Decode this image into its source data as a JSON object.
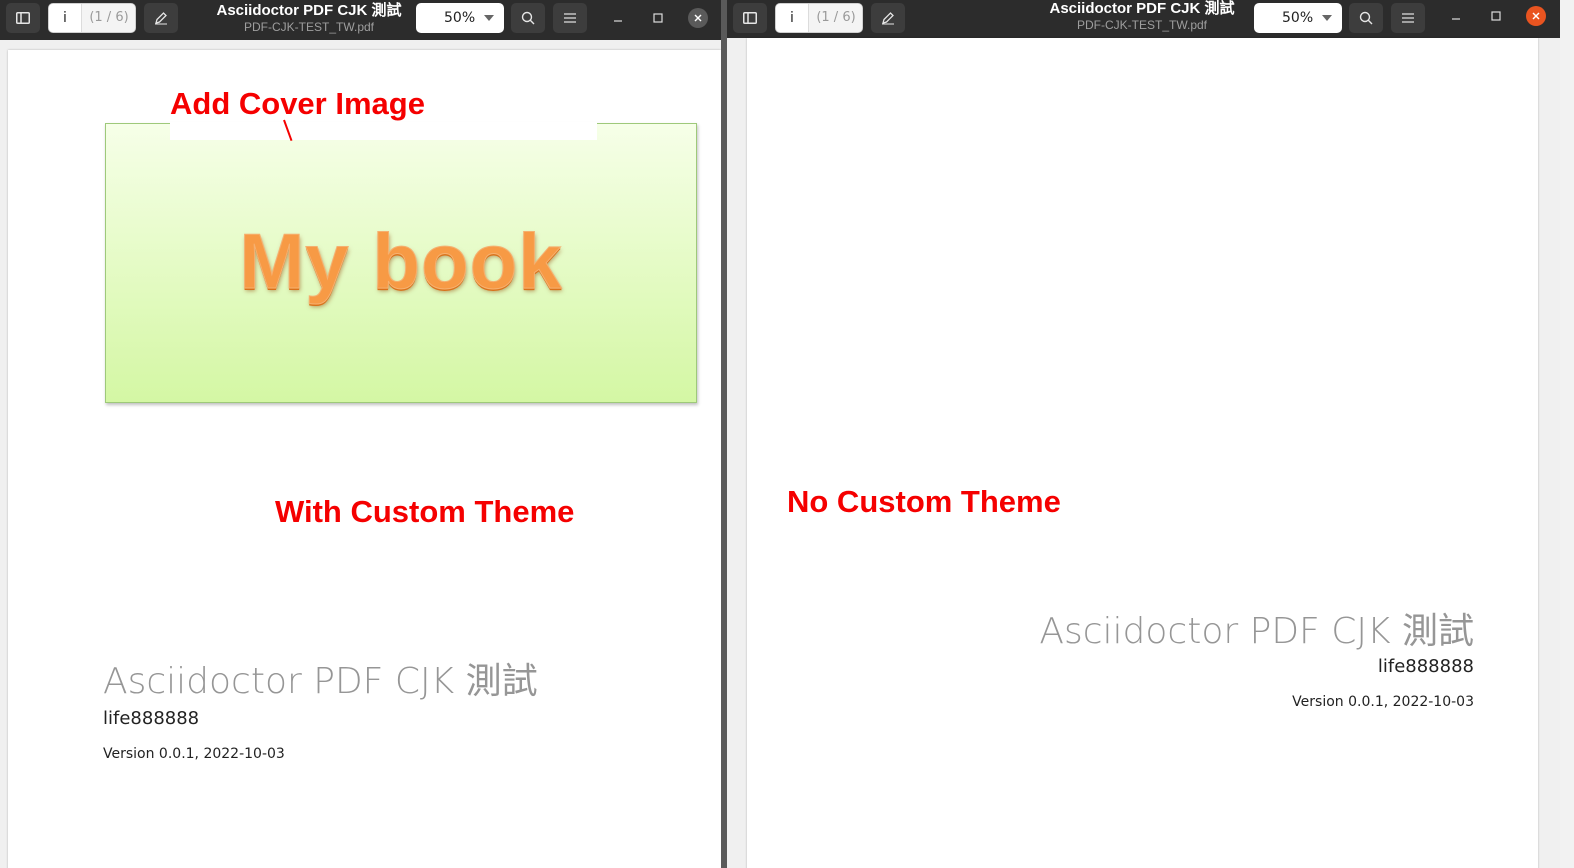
{
  "windows": [
    {
      "title": "Asciidoctor PDF CJK 測試",
      "subtitle": "PDF-CJK-TEST_TW.pdf",
      "page_input": "i",
      "page_count": "(1 / 6)",
      "zoom": "50%"
    },
    {
      "title": "Asciidoctor PDF CJK 測試",
      "subtitle": "PDF-CJK-TEST_TW.pdf",
      "page_input": "i",
      "page_count": "(1 / 6)",
      "zoom": "50%"
    }
  ],
  "icons": {
    "sidebar": "sidebar-toggle-icon",
    "annotate": "pencil-icon",
    "search": "search-icon",
    "menu": "hamburger-menu-icon",
    "minimize": "minimize-icon",
    "maximize": "maximize-icon",
    "close": "close-icon"
  },
  "left_page": {
    "cover_image_text": "My book",
    "annotation_cover": "Add Cover Image",
    "annotation_theme": "With Custom Theme",
    "doc_title": "Asciidoctor PDF CJK 測試",
    "author": "life888888",
    "version": "Version 0.0.1, 2022-10-03"
  },
  "right_page": {
    "annotation_theme": "No Custom Theme",
    "doc_title": "Asciidoctor PDF CJK 測試",
    "author": "life888888",
    "version": "Version 0.0.1, 2022-10-03"
  },
  "colors": {
    "annotation_red": "#f50000",
    "close_button_left": "#5a5a5a",
    "close_button_right": "#e95420",
    "titlebar": "#2c2c2c"
  }
}
